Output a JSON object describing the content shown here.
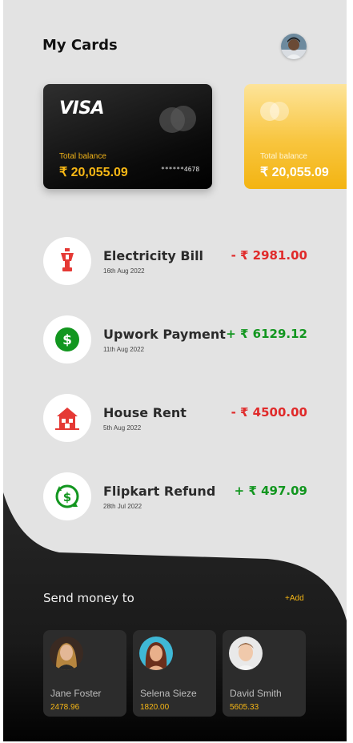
{
  "header": {
    "title": "My Cards"
  },
  "cards": [
    {
      "brand": "VISA",
      "balance_label": "Total balance",
      "balance": "₹ 20,055.09",
      "number": "******4678"
    },
    {
      "balance_label": "Total balance",
      "balance": "₹ 20,055.09"
    }
  ],
  "transactions": [
    {
      "title": "Electricity Bill",
      "date": "16th Aug 2022",
      "amount": "- ₹ 2981.00",
      "icon": "electricity-icon",
      "type": "debit"
    },
    {
      "title": "Upwork Payment",
      "date": "11th Aug 2022",
      "amount": "+ ₹ 6129.12",
      "icon": "dollar-icon",
      "type": "credit"
    },
    {
      "title": "House Rent",
      "date": "5th Aug 2022",
      "amount": "- ₹ 4500.00",
      "icon": "house-icon",
      "type": "debit"
    },
    {
      "title": "Flipkart Refund",
      "date": "28th Jul 2022",
      "amount": "+ ₹ 497.09",
      "icon": "refund-icon",
      "type": "credit"
    }
  ],
  "send_money": {
    "title": "Send money to",
    "add_label": "+Add",
    "contacts": [
      {
        "name": "Jane Foster",
        "amount": "2478.96"
      },
      {
        "name": "Selena Sieze",
        "amount": "1820.00"
      },
      {
        "name": "David Smith",
        "amount": "5605.33"
      }
    ]
  },
  "colors": {
    "accent": "#f7b715",
    "debit": "#e02a2a",
    "credit": "#12961f",
    "background": "#e3e3e3",
    "panel": "#1c1c1c"
  }
}
